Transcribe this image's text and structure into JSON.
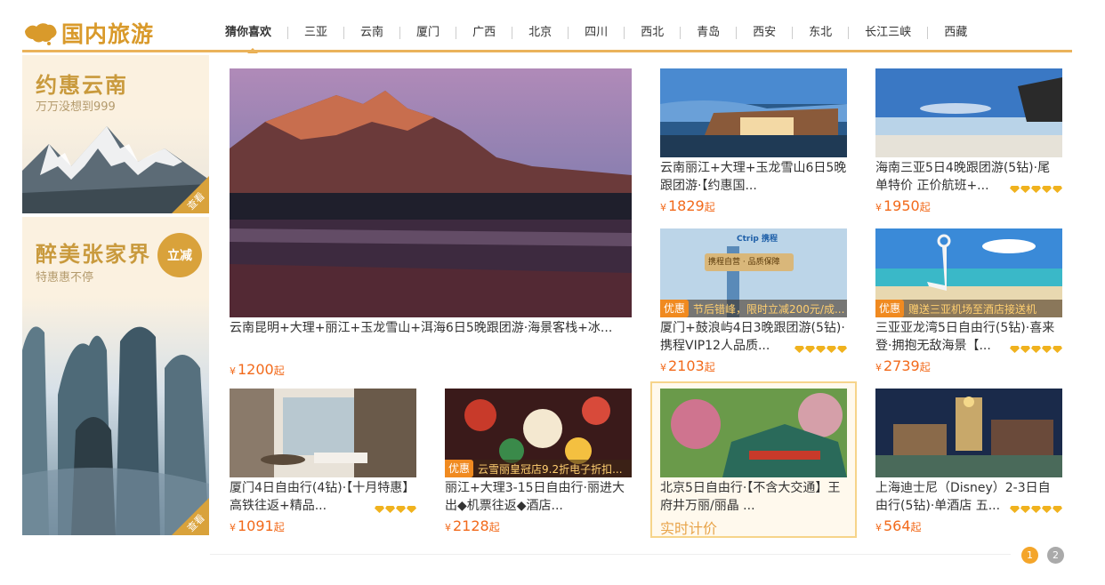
{
  "logo": {
    "text": "国内旅游",
    "icon": "china-map-icon"
  },
  "nav": [
    "猜你喜欢",
    "三亚",
    "云南",
    "厦门",
    "广西",
    "北京",
    "四川",
    "西北",
    "青岛",
    "西安",
    "东北",
    "长江三峡",
    "西藏"
  ],
  "banners": [
    {
      "title": "约惠云南",
      "subtitle": "万万没想到999",
      "corner": "查看"
    },
    {
      "title": "醉美张家界",
      "subtitle": "特惠惠不停",
      "badge": "立减",
      "corner": "查看"
    }
  ],
  "cards": [
    {
      "title": "云南昆明+大理+丽江+玉龙雪山+洱海6日5晚跟团游·海景客栈+冰...",
      "currency": "¥",
      "price": "1200",
      "suffix": "起"
    },
    {
      "title": "云南丽江+大理+玉龙雪山6日5晚跟团游·【约惠国...",
      "currency": "¥",
      "price": "1829",
      "suffix": "起"
    },
    {
      "title": "海南三亚5日4晚跟团游(5钻)·尾单特价 正价航班+...",
      "currency": "¥",
      "price": "1950",
      "suffix": "起",
      "diamonds": 5
    },
    {
      "title": "厦门+鼓浪屿4日3晚跟团游(5钻)·携程VIP12人品质...",
      "currency": "¥",
      "price": "2103",
      "suffix": "起",
      "diamonds": 5,
      "promo_tag": "优惠",
      "promo": "节后错峰，限时立减200元/成...",
      "img_text": "携程自营 · 品质保障",
      "img_brand": "Ctrip 携程"
    },
    {
      "title": "三亚亚龙湾5日自由行(5钻)·喜来登·拥抱无敌海景【...",
      "currency": "¥",
      "price": "2739",
      "suffix": "起",
      "diamonds": 5,
      "promo_tag": "优惠",
      "promo": "赠送三亚机场至酒店接送机"
    },
    {
      "title": "厦门4日自由行(4钻)·【十月特惠】高铁往返+精品...",
      "currency": "¥",
      "price": "1091",
      "suffix": "起",
      "diamonds": 4
    },
    {
      "title": "丽江+大理3-15日自由行·丽进大出◆机票往返◆酒店...",
      "currency": "¥",
      "price": "2128",
      "suffix": "起",
      "promo_tag": "优惠",
      "promo": "云雪丽皇冠店9.2折电子折扣..."
    },
    {
      "title": "北京5日自由行·【不含大交通】王府井万丽/丽晶 ...",
      "realtime": "实时计价"
    },
    {
      "title": "上海迪士尼（Disney）2-3日自由行(5钻)·单酒店 五...",
      "currency": "¥",
      "price": "564",
      "suffix": "起",
      "diamonds": 5
    }
  ],
  "pager": [
    "1",
    "2"
  ],
  "colors": {
    "accent": "#eab35b",
    "price": "#f26a1b",
    "gold": "#d9a23b"
  }
}
